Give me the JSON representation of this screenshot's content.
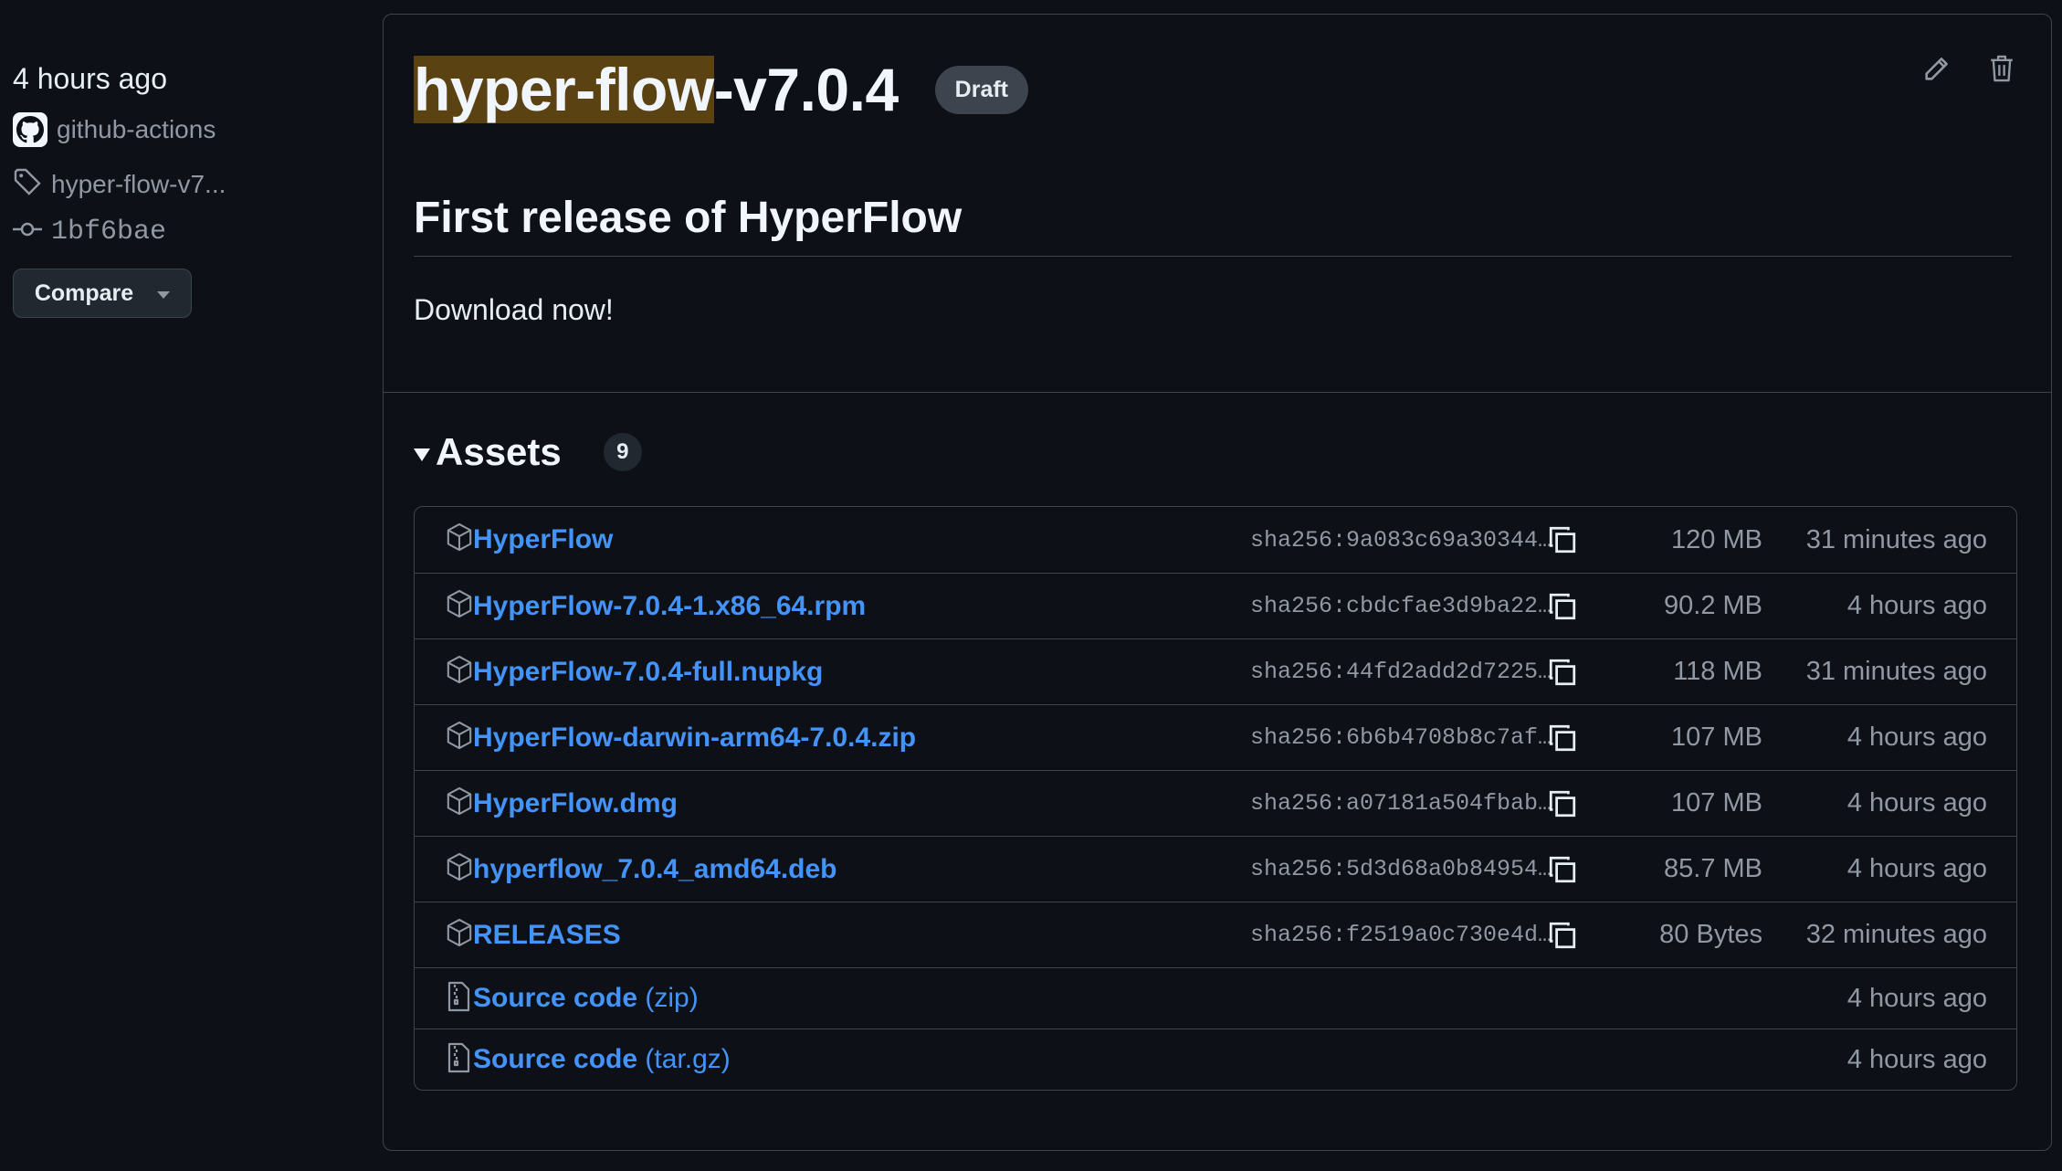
{
  "sidebar": {
    "time": "4 hours ago",
    "author": "github-actions",
    "tag": "hyper-flow-v7...",
    "commit": "1bf6bae",
    "compare_label": "Compare"
  },
  "release": {
    "title_highlight": "hyper-flow",
    "title_rest": "-v7.0.4",
    "badge": "Draft",
    "heading": "First release of HyperFlow",
    "body": "Download now!"
  },
  "assets": {
    "label": "Assets",
    "count": "9",
    "rows": [
      {
        "name": "HyperFlow",
        "sha": "sha256:9a083c69a30344…",
        "size": "120 MB",
        "time": "31 minutes ago"
      },
      {
        "name": "HyperFlow-7.0.4-1.x86_64.rpm",
        "sha": "sha256:cbdcfae3d9ba22…",
        "size": "90.2 MB",
        "time": "4 hours ago"
      },
      {
        "name": "HyperFlow-7.0.4-full.nupkg",
        "sha": "sha256:44fd2add2d7225…",
        "size": "118 MB",
        "time": "31 minutes ago"
      },
      {
        "name": "HyperFlow-darwin-arm64-7.0.4.zip",
        "sha": "sha256:6b6b4708b8c7af…",
        "size": "107 MB",
        "time": "4 hours ago"
      },
      {
        "name": "HyperFlow.dmg",
        "sha": "sha256:a07181a504fbab…",
        "size": "107 MB",
        "time": "4 hours ago"
      },
      {
        "name": "hyperflow_7.0.4_amd64.deb",
        "sha": "sha256:5d3d68a0b84954…",
        "size": "85.7 MB",
        "time": "4 hours ago"
      },
      {
        "name": "RELEASES",
        "sha": "sha256:f2519a0c730e4d…",
        "size": "80 Bytes",
        "time": "32 minutes ago"
      }
    ],
    "sources": [
      {
        "name": "Source code",
        "suffix": "(zip)",
        "time": "4 hours ago"
      },
      {
        "name": "Source code",
        "suffix": "(tar.gz)",
        "time": "4 hours ago"
      }
    ]
  }
}
